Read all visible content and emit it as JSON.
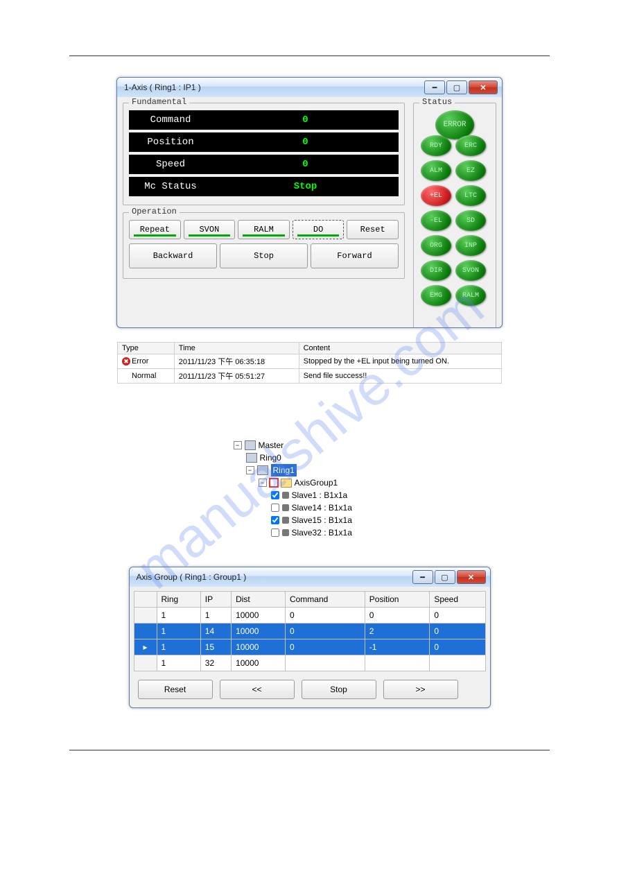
{
  "axis_window": {
    "title": "1-Axis ( Ring1 : IP1 )",
    "fundamental_legend": "Fundamental",
    "operation_legend": "Operation",
    "status_legend": "Status",
    "fund_rows": {
      "command_label": "Command",
      "command_value": "0",
      "position_label": "Position",
      "position_value": "0",
      "speed_label": "Speed",
      "speed_value": "0",
      "mc_label": "Mc Status",
      "mc_value": "Stop"
    },
    "op_buttons": {
      "repeat": "Repeat",
      "svon": "SVON",
      "ralm": "RALM",
      "do": "DO",
      "reset": "Reset",
      "backward": "Backward",
      "stop": "Stop",
      "forward": "Forward"
    },
    "status_leds": {
      "error": "ERROR",
      "rdy": "RDY",
      "erc": "ERC",
      "alm": "ALM",
      "ez": "EZ",
      "pel": "+EL",
      "ltc": "LTC",
      "mel": "-EL",
      "sd": "SD",
      "org": "ORG",
      "inp": "INP",
      "dir": "DIR",
      "svon": "SVON",
      "emg": "EMG",
      "ralm": "RALM"
    }
  },
  "log": {
    "cols": {
      "type": "Type",
      "time": "Time",
      "content": "Content"
    },
    "rows": [
      {
        "type": "Error",
        "time": "2011/11/23 下午 06:35:18",
        "content": "Stopped by the +EL input being turned ON."
      },
      {
        "type": "Normal",
        "time": "2011/11/23 下午 05:51:27",
        "content": "Send file success!!"
      }
    ]
  },
  "tree": {
    "master": "Master",
    "ring0": "Ring0",
    "ring1": "Ring1",
    "axisgroup1": "AxisGroup1",
    "slaves": [
      {
        "name": "Slave1 : B1x1a",
        "checked": true
      },
      {
        "name": "Slave14 : B1x1a",
        "checked": false
      },
      {
        "name": "Slave15 : B1x1a",
        "checked": true
      },
      {
        "name": "Slave32 : B1x1a",
        "checked": false
      }
    ]
  },
  "group_window": {
    "title": "Axis Group ( Ring1 : Group1 )",
    "cols": {
      "ring": "Ring",
      "ip": "IP",
      "dist": "Dist",
      "command": "Command",
      "position": "Position",
      "speed": "Speed"
    },
    "rows": [
      {
        "ring": "1",
        "ip": "1",
        "dist": "10000",
        "command": "0",
        "position": "0",
        "speed": "0",
        "sel": false,
        "cursor": false
      },
      {
        "ring": "1",
        "ip": "14",
        "dist": "10000",
        "command": "0",
        "position": "2",
        "speed": "0",
        "sel": true,
        "cursor": false
      },
      {
        "ring": "1",
        "ip": "15",
        "dist": "10000",
        "command": "0",
        "position": "-1",
        "speed": "0",
        "sel": true,
        "cursor": true
      },
      {
        "ring": "1",
        "ip": "32",
        "dist": "10000",
        "command": "",
        "position": "",
        "speed": "",
        "sel": false,
        "cursor": false
      }
    ],
    "buttons": {
      "reset": "Reset",
      "back": "<<",
      "stop": "Stop",
      "fwd": ">>"
    }
  },
  "watermark": "manualshive.com"
}
